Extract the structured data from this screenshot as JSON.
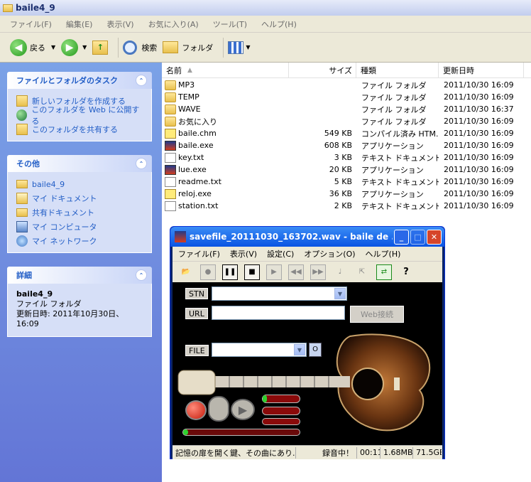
{
  "window": {
    "title": "baile4_9"
  },
  "menu": [
    "ファイル(F)",
    "編集(E)",
    "表示(V)",
    "お気に入り(A)",
    "ツール(T)",
    "ヘルプ(H)"
  ],
  "toolbar": {
    "back": "戻る",
    "search": "検索",
    "folders": "フォルダ"
  },
  "tasks": {
    "title": "ファイルとフォルダのタスク",
    "items": [
      "新しいフォルダを作成する",
      "このフォルダを Web に公開する",
      "このフォルダを共有する"
    ]
  },
  "other": {
    "title": "その他",
    "items": [
      "baile4_9",
      "マイ ドキュメント",
      "共有ドキュメント",
      "マイ コンピュータ",
      "マイ ネットワーク"
    ]
  },
  "details": {
    "title": "詳細",
    "name": "baile4_9",
    "type": "ファイル フォルダ",
    "modified": "更新日時: 2011年10月30日、16:09"
  },
  "columns": {
    "name": "名前",
    "size": "サイズ",
    "type": "種類",
    "date": "更新日時"
  },
  "files": [
    {
      "name": "MP3",
      "size": "",
      "type": "ファイル フォルダ",
      "date": "2011/10/30 16:09",
      "icon": "folder"
    },
    {
      "name": "TEMP",
      "size": "",
      "type": "ファイル フォルダ",
      "date": "2011/10/30 16:09",
      "icon": "folder"
    },
    {
      "name": "WAVE",
      "size": "",
      "type": "ファイル フォルダ",
      "date": "2011/10/30 16:37",
      "icon": "folder"
    },
    {
      "name": "お気に入り",
      "size": "",
      "type": "ファイル フォルダ",
      "date": "2011/10/30 16:09",
      "icon": "folder"
    },
    {
      "name": "baile.chm",
      "size": "549 KB",
      "type": "コンパイル済み HTM...",
      "date": "2011/10/30 16:09",
      "icon": "chm"
    },
    {
      "name": "baile.exe",
      "size": "608 KB",
      "type": "アプリケーション",
      "date": "2011/10/30 16:09",
      "icon": "exe"
    },
    {
      "name": "key.txt",
      "size": "3 KB",
      "type": "テキスト ドキュメント",
      "date": "2011/10/30 16:09",
      "icon": "doc"
    },
    {
      "name": "lue.exe",
      "size": "20 KB",
      "type": "アプリケーション",
      "date": "2011/10/30 16:09",
      "icon": "exe"
    },
    {
      "name": "readme.txt",
      "size": "5 KB",
      "type": "テキスト ドキュメント",
      "date": "2011/10/30 16:09",
      "icon": "doc"
    },
    {
      "name": "reloj.exe",
      "size": "36 KB",
      "type": "アプリケーション",
      "date": "2011/10/30 16:09",
      "icon": "chm"
    },
    {
      "name": "station.txt",
      "size": "2 KB",
      "type": "テキスト ドキュメント",
      "date": "2011/10/30 16:09",
      "icon": "doc"
    }
  ],
  "baile": {
    "title": "savefile_20111030_163702.wav - baile de ...",
    "menu": [
      "ファイル(F)",
      "表示(V)",
      "設定(C)",
      "オプション(O)",
      "ヘルプ(H)"
    ],
    "stn_label": "STN",
    "url_label": "URL",
    "web_button": "Web接続",
    "file_label": "FILE",
    "status": {
      "message": "記憶の扉を開く鍵、その曲にあり...",
      "state": "録音中！",
      "time": "00:11",
      "size": "1.68MB",
      "free": "71.5GB"
    }
  }
}
